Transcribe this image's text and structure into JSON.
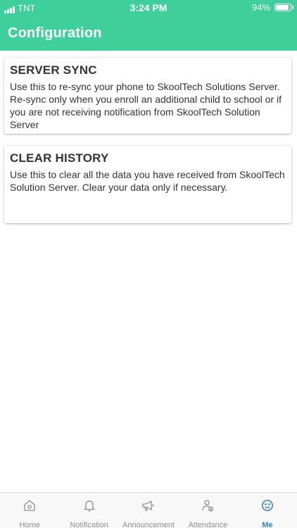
{
  "status_bar": {
    "carrier": "TNT",
    "time": "3:24 PM",
    "battery_text": "94%",
    "battery_level": 0.94
  },
  "header": {
    "title": "Configuration",
    "color": "#3ecf9b"
  },
  "cards": [
    {
      "title": "SERVER SYNC",
      "description": "Use this to re-sync your phone to SkoolTech Solutions Server. Re-sync only when you enroll an additional child to school or if you are not receiving notification from SkoolTech Solution Server"
    },
    {
      "title": "CLEAR HISTORY",
      "description": "Use this to clear all the data you have received from SkoolTech Solution Server. Clear your data only if necessary."
    }
  ],
  "tabbar": {
    "active_color": "#2f80c4",
    "items": [
      {
        "label": "Home",
        "icon": "home-icon"
      },
      {
        "label": "Notification",
        "icon": "bell-icon"
      },
      {
        "label": "Announcement",
        "icon": "megaphone-icon"
      },
      {
        "label": "Attendance",
        "icon": "person-check-icon"
      },
      {
        "label": "Me",
        "icon": "smiley-icon",
        "active": true
      }
    ]
  }
}
